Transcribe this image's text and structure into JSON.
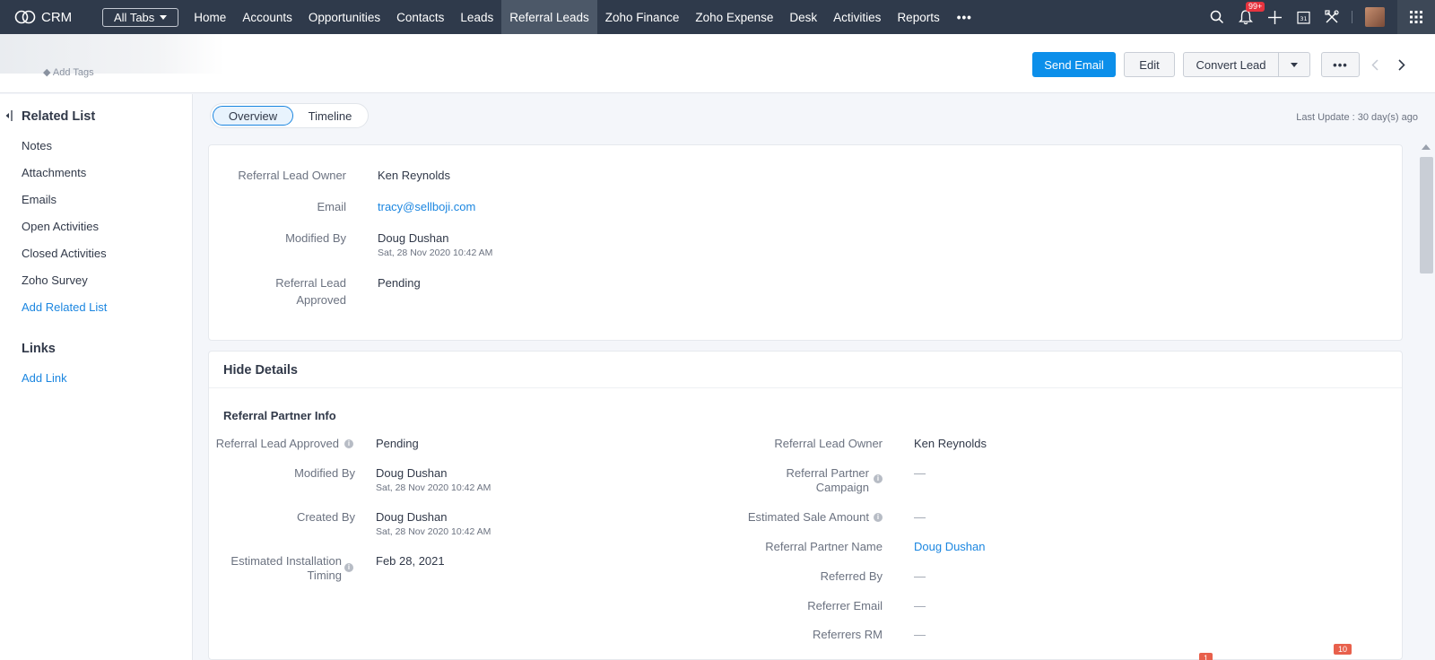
{
  "nav": {
    "logo_text": "CRM",
    "all_tabs": "All Tabs",
    "tabs": [
      {
        "label": "Home"
      },
      {
        "label": "Accounts"
      },
      {
        "label": "Opportunities"
      },
      {
        "label": "Contacts"
      },
      {
        "label": "Leads"
      },
      {
        "label": "Referral Leads"
      },
      {
        "label": "Zoho Finance"
      },
      {
        "label": "Zoho Expense"
      },
      {
        "label": "Desk"
      },
      {
        "label": "Activities"
      },
      {
        "label": "Reports"
      },
      {
        "label": "•••"
      }
    ],
    "active_tab": "Referral Leads",
    "notification_badge": "99+",
    "calendar_day": "31"
  },
  "header": {
    "add_tags": "Add Tags",
    "send_email": "Send Email",
    "edit": "Edit",
    "convert_lead": "Convert Lead",
    "more": "•••"
  },
  "sidebar": {
    "related_list_title": "Related List",
    "items": [
      {
        "label": "Notes"
      },
      {
        "label": "Attachments"
      },
      {
        "label": "Emails"
      },
      {
        "label": "Open Activities"
      },
      {
        "label": "Closed Activities"
      },
      {
        "label": "Zoho Survey"
      }
    ],
    "add_related_list": "Add Related List",
    "links_title": "Links",
    "add_link": "Add Link"
  },
  "view_toggle": {
    "overview": "Overview",
    "timeline": "Timeline"
  },
  "last_update": "Last Update : 30 day(s) ago",
  "summary": {
    "owner_label": "Referral Lead Owner",
    "owner_value": "Ken Reynolds",
    "email_label": "Email",
    "email_value": "tracy@sellboji.com",
    "modified_label": "Modified By",
    "modified_value": "Doug Dushan",
    "modified_date": "Sat, 28 Nov 2020 10:42 AM",
    "approved_label_1": "Referral Lead",
    "approved_label_2": "Approved",
    "approved_value": "Pending"
  },
  "details": {
    "hide_details": "Hide Details",
    "section_title": "Referral Partner Info",
    "left": {
      "approved_label": "Referral Lead Approved",
      "approved_value": "Pending",
      "modified_label": "Modified By",
      "modified_value": "Doug Dushan",
      "modified_date": "Sat, 28 Nov 2020 10:42 AM",
      "created_label": "Created By",
      "created_value": "Doug Dushan",
      "created_date": "Sat, 28 Nov 2020 10:42 AM",
      "install_label_1": "Estimated Installation",
      "install_label_2": "Timing",
      "install_value": "Feb 28, 2021"
    },
    "right": {
      "owner_label": "Referral Lead Owner",
      "owner_value": "Ken Reynolds",
      "campaign_label_1": "Referral Partner",
      "campaign_label_2": "Campaign",
      "campaign_value": "—",
      "sale_label": "Estimated Sale Amount",
      "sale_value": "—",
      "partner_label": "Referral Partner Name",
      "partner_value": "Doug Dushan",
      "referred_label": "Referred By",
      "referred_value": "—",
      "referrer_email_label": "Referrer Email",
      "referrer_email_value": "—",
      "referrers_rm_label": "Referrers RM",
      "referrers_rm_value": "—"
    }
  },
  "bottom_badges": {
    "left": "1",
    "right": "10"
  }
}
